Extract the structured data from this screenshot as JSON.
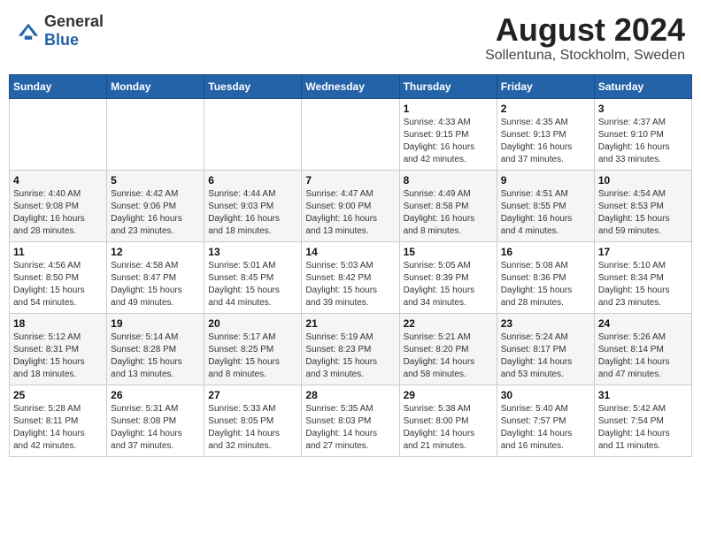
{
  "header": {
    "logo_general": "General",
    "logo_blue": "Blue",
    "month_title": "August 2024",
    "location": "Sollentuna, Stockholm, Sweden"
  },
  "days_of_week": [
    "Sunday",
    "Monday",
    "Tuesday",
    "Wednesday",
    "Thursday",
    "Friday",
    "Saturday"
  ],
  "weeks": [
    [
      {
        "day": "",
        "info": ""
      },
      {
        "day": "",
        "info": ""
      },
      {
        "day": "",
        "info": ""
      },
      {
        "day": "",
        "info": ""
      },
      {
        "day": "1",
        "info": "Sunrise: 4:33 AM\nSunset: 9:15 PM\nDaylight: 16 hours\nand 42 minutes."
      },
      {
        "day": "2",
        "info": "Sunrise: 4:35 AM\nSunset: 9:13 PM\nDaylight: 16 hours\nand 37 minutes."
      },
      {
        "day": "3",
        "info": "Sunrise: 4:37 AM\nSunset: 9:10 PM\nDaylight: 16 hours\nand 33 minutes."
      }
    ],
    [
      {
        "day": "4",
        "info": "Sunrise: 4:40 AM\nSunset: 9:08 PM\nDaylight: 16 hours\nand 28 minutes."
      },
      {
        "day": "5",
        "info": "Sunrise: 4:42 AM\nSunset: 9:06 PM\nDaylight: 16 hours\nand 23 minutes."
      },
      {
        "day": "6",
        "info": "Sunrise: 4:44 AM\nSunset: 9:03 PM\nDaylight: 16 hours\nand 18 minutes."
      },
      {
        "day": "7",
        "info": "Sunrise: 4:47 AM\nSunset: 9:00 PM\nDaylight: 16 hours\nand 13 minutes."
      },
      {
        "day": "8",
        "info": "Sunrise: 4:49 AM\nSunset: 8:58 PM\nDaylight: 16 hours\nand 8 minutes."
      },
      {
        "day": "9",
        "info": "Sunrise: 4:51 AM\nSunset: 8:55 PM\nDaylight: 16 hours\nand 4 minutes."
      },
      {
        "day": "10",
        "info": "Sunrise: 4:54 AM\nSunset: 8:53 PM\nDaylight: 15 hours\nand 59 minutes."
      }
    ],
    [
      {
        "day": "11",
        "info": "Sunrise: 4:56 AM\nSunset: 8:50 PM\nDaylight: 15 hours\nand 54 minutes."
      },
      {
        "day": "12",
        "info": "Sunrise: 4:58 AM\nSunset: 8:47 PM\nDaylight: 15 hours\nand 49 minutes."
      },
      {
        "day": "13",
        "info": "Sunrise: 5:01 AM\nSunset: 8:45 PM\nDaylight: 15 hours\nand 44 minutes."
      },
      {
        "day": "14",
        "info": "Sunrise: 5:03 AM\nSunset: 8:42 PM\nDaylight: 15 hours\nand 39 minutes."
      },
      {
        "day": "15",
        "info": "Sunrise: 5:05 AM\nSunset: 8:39 PM\nDaylight: 15 hours\nand 34 minutes."
      },
      {
        "day": "16",
        "info": "Sunrise: 5:08 AM\nSunset: 8:36 PM\nDaylight: 15 hours\nand 28 minutes."
      },
      {
        "day": "17",
        "info": "Sunrise: 5:10 AM\nSunset: 8:34 PM\nDaylight: 15 hours\nand 23 minutes."
      }
    ],
    [
      {
        "day": "18",
        "info": "Sunrise: 5:12 AM\nSunset: 8:31 PM\nDaylight: 15 hours\nand 18 minutes."
      },
      {
        "day": "19",
        "info": "Sunrise: 5:14 AM\nSunset: 8:28 PM\nDaylight: 15 hours\nand 13 minutes."
      },
      {
        "day": "20",
        "info": "Sunrise: 5:17 AM\nSunset: 8:25 PM\nDaylight: 15 hours\nand 8 minutes."
      },
      {
        "day": "21",
        "info": "Sunrise: 5:19 AM\nSunset: 8:23 PM\nDaylight: 15 hours\nand 3 minutes."
      },
      {
        "day": "22",
        "info": "Sunrise: 5:21 AM\nSunset: 8:20 PM\nDaylight: 14 hours\nand 58 minutes."
      },
      {
        "day": "23",
        "info": "Sunrise: 5:24 AM\nSunset: 8:17 PM\nDaylight: 14 hours\nand 53 minutes."
      },
      {
        "day": "24",
        "info": "Sunrise: 5:26 AM\nSunset: 8:14 PM\nDaylight: 14 hours\nand 47 minutes."
      }
    ],
    [
      {
        "day": "25",
        "info": "Sunrise: 5:28 AM\nSunset: 8:11 PM\nDaylight: 14 hours\nand 42 minutes."
      },
      {
        "day": "26",
        "info": "Sunrise: 5:31 AM\nSunset: 8:08 PM\nDaylight: 14 hours\nand 37 minutes."
      },
      {
        "day": "27",
        "info": "Sunrise: 5:33 AM\nSunset: 8:05 PM\nDaylight: 14 hours\nand 32 minutes."
      },
      {
        "day": "28",
        "info": "Sunrise: 5:35 AM\nSunset: 8:03 PM\nDaylight: 14 hours\nand 27 minutes."
      },
      {
        "day": "29",
        "info": "Sunrise: 5:38 AM\nSunset: 8:00 PM\nDaylight: 14 hours\nand 21 minutes."
      },
      {
        "day": "30",
        "info": "Sunrise: 5:40 AM\nSunset: 7:57 PM\nDaylight: 14 hours\nand 16 minutes."
      },
      {
        "day": "31",
        "info": "Sunrise: 5:42 AM\nSunset: 7:54 PM\nDaylight: 14 hours\nand 11 minutes."
      }
    ]
  ]
}
